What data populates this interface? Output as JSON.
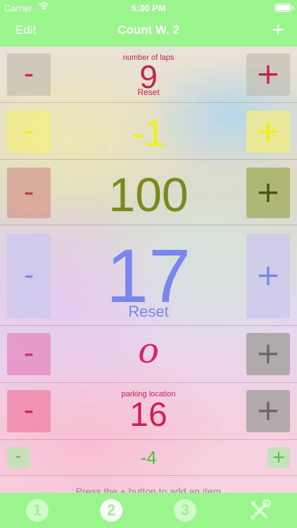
{
  "status_bar": {
    "carrier": "Carrier",
    "time": "5:30 PM"
  },
  "nav": {
    "edit_label": "Edit",
    "title": "Count W. 2",
    "add_label": "+"
  },
  "counters": [
    {
      "label": "number of laps",
      "value": "9",
      "reset": "Reset",
      "minus": "-",
      "plus": "+",
      "color": "#c4234f"
    },
    {
      "label": "",
      "value": "-1",
      "reset": "",
      "minus": "-",
      "plus": "+",
      "color": "#f2ee1a"
    },
    {
      "label": "",
      "value": "100",
      "reset": "",
      "minus": "-",
      "plus": "+",
      "color": "#7a8a1e"
    },
    {
      "label": "",
      "value": "17",
      "reset": "Reset",
      "minus": "-",
      "plus": "+",
      "color": "#7b86ec"
    },
    {
      "label": "",
      "value": "o",
      "reset": "",
      "minus": "-",
      "plus": "+",
      "color": "#d7256b"
    },
    {
      "label": "parking location",
      "value": "16",
      "reset": "",
      "minus": "-",
      "plus": "+",
      "color": "#cc2253"
    },
    {
      "label": "",
      "value": "-4",
      "reset": "",
      "minus": "-",
      "plus": "+",
      "color": "#3ec93a"
    }
  ],
  "hint": "Press the + button to add an item",
  "tabs": [
    {
      "label": "1",
      "icon": "circle-1-icon"
    },
    {
      "label": "2",
      "icon": "circle-2-icon"
    },
    {
      "label": "3",
      "icon": "circle-3-icon"
    },
    {
      "label": "",
      "icon": "tools-icon"
    }
  ],
  "colors": {
    "accent_green": "#99f58c",
    "white": "#ffffff",
    "gray_button": "#a7a2a2"
  }
}
